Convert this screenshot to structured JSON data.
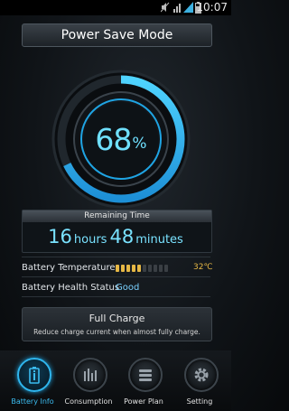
{
  "status_bar": {
    "time": "10:07"
  },
  "title": "Power Save Mode",
  "battery": {
    "percent_value": "68",
    "percent_sign": "%",
    "level": 0.68
  },
  "remaining": {
    "label": "Remaining Time",
    "hours": "16",
    "hours_unit": "hours",
    "minutes": "48",
    "minutes_unit": "minutes"
  },
  "temperature": {
    "label": "Battery Temperature",
    "value": "32℃",
    "bars_lit": 5,
    "bars_total": 10,
    "lit_color": "#e6b845",
    "unlit_color": "#3a3f44"
  },
  "health": {
    "label": "Battery Health Status",
    "value": "Good"
  },
  "full_charge": {
    "title": "Full Charge",
    "description": "Reduce charge current when almost fully charge."
  },
  "nav": [
    {
      "label": "Battery Info",
      "icon": "battery-icon",
      "active": true
    },
    {
      "label": "Consumption",
      "icon": "consumption-icon",
      "active": false
    },
    {
      "label": "Power Plan",
      "icon": "power-plan-icon",
      "active": false
    },
    {
      "label": "Setting",
      "icon": "gear-icon",
      "active": false
    }
  ],
  "colors": {
    "accent": "#2fb6ee",
    "text_accent": "#79e2ff"
  }
}
